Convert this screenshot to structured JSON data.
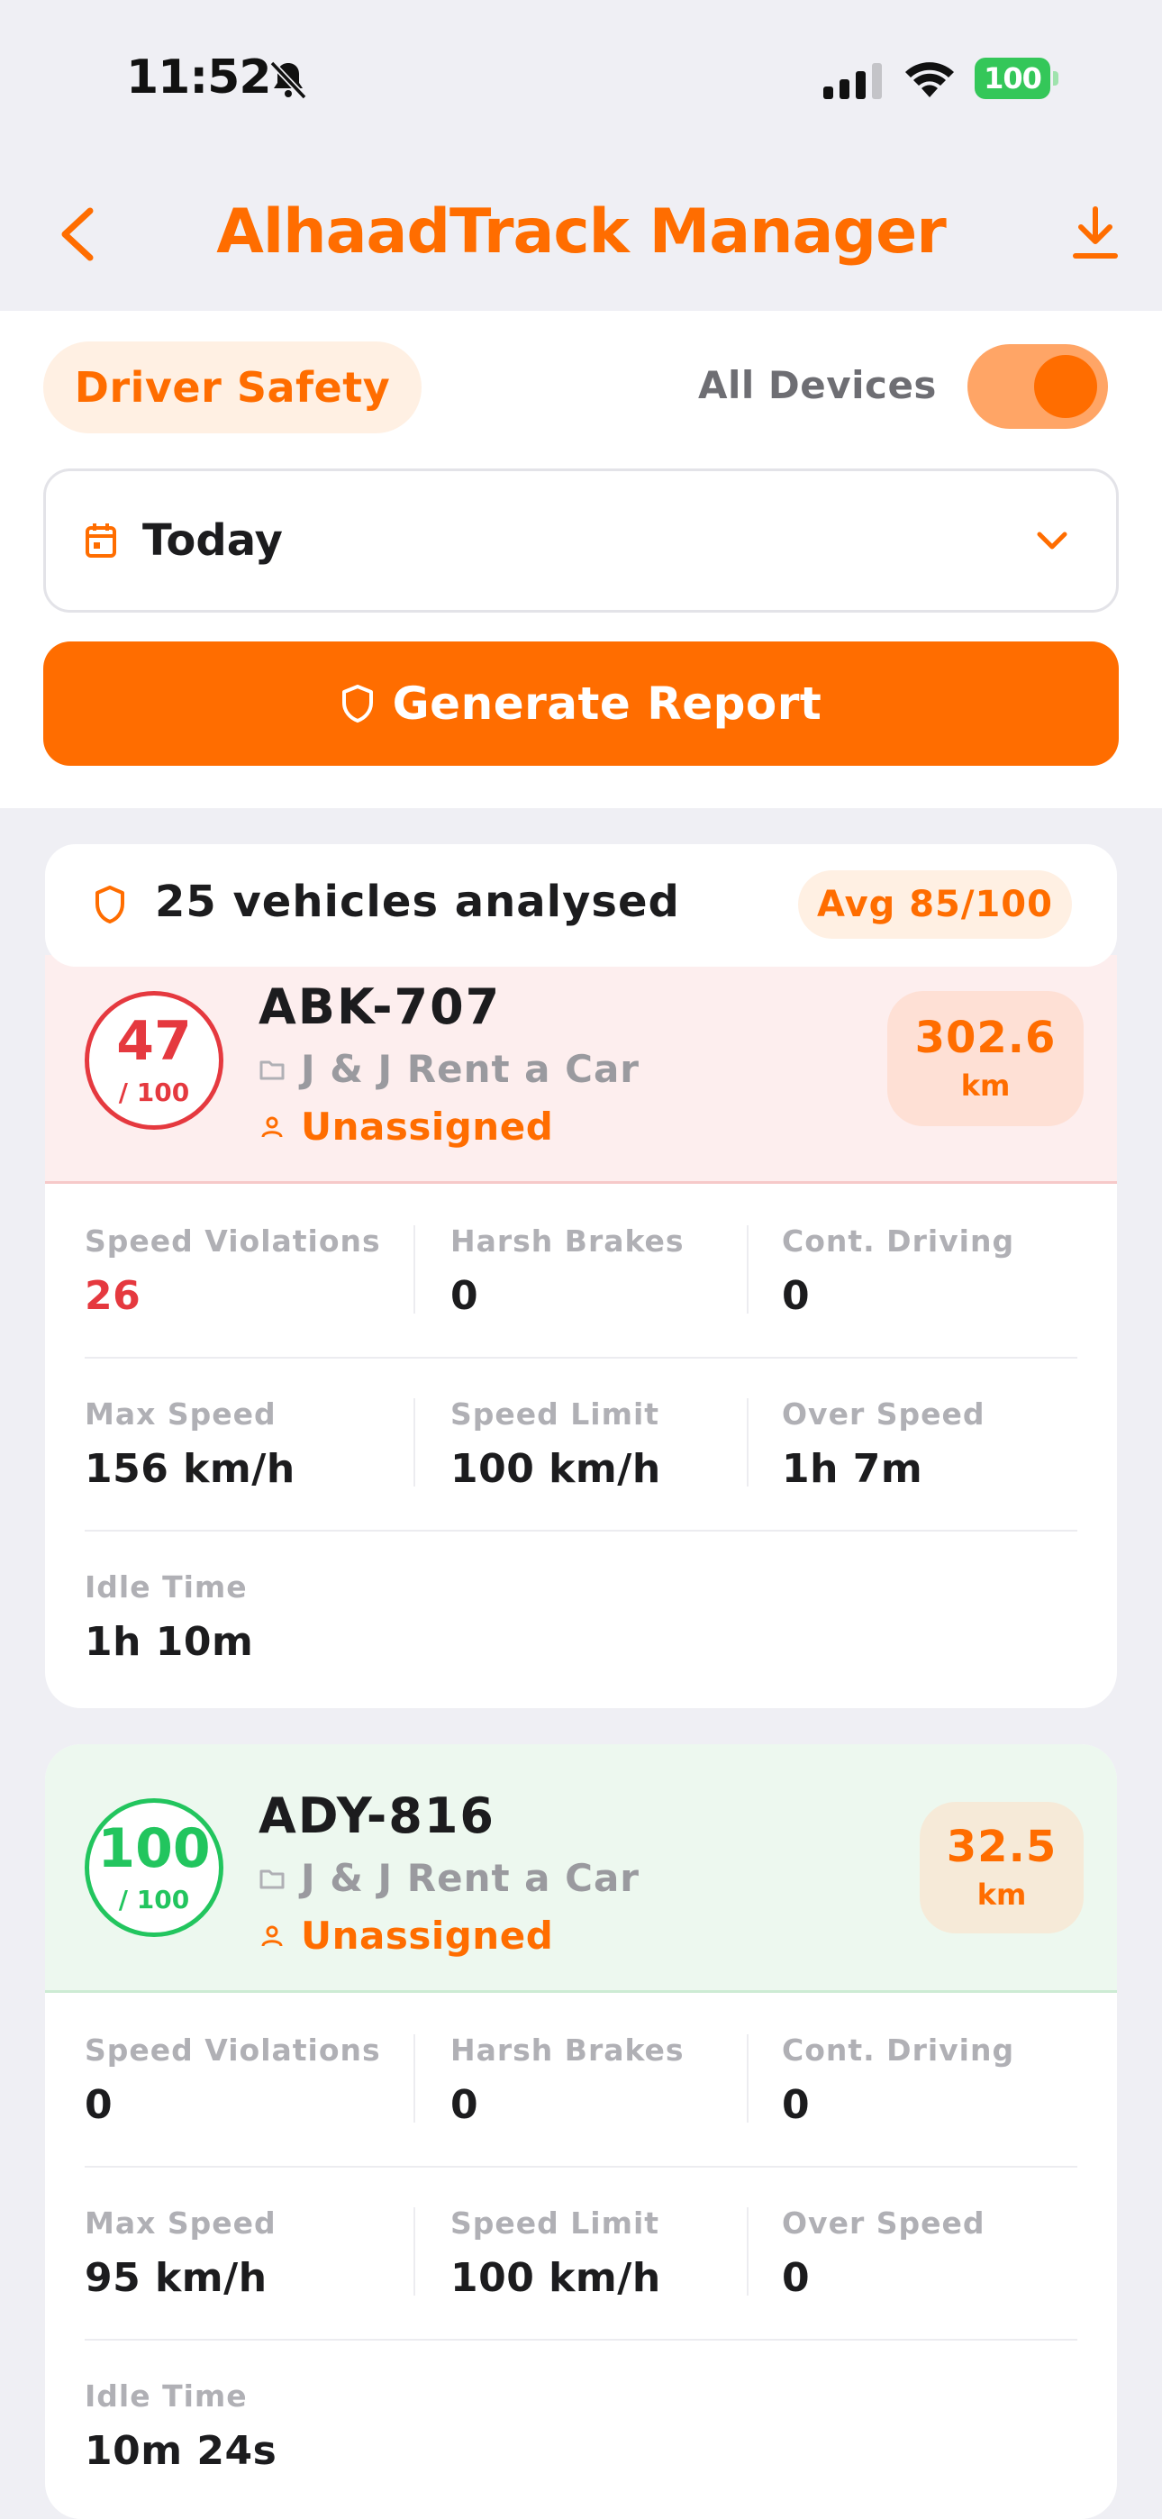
{
  "status_bar": {
    "time": "11:52",
    "battery": "100"
  },
  "nav": {
    "title": "AlhaadTrack Manager"
  },
  "controls": {
    "mode_chip": "Driver Safety",
    "all_devices_label": "All Devices",
    "all_devices_on": true,
    "date_value": "Today",
    "generate_label": "Generate Report"
  },
  "summary": {
    "text": "25 vehicles analysed",
    "avg": "Avg 85/100"
  },
  "vehicles": [
    {
      "score": "47",
      "score_max": "/ 100",
      "plate": "ABK-707",
      "company": "J & J Rent a Car",
      "driver": "Unassigned",
      "km": "302.6",
      "km_unit": "km",
      "stats": {
        "speed_violations_label": "Speed Violations",
        "speed_violations": "26",
        "harsh_brakes_label": "Harsh Brakes",
        "harsh_brakes": "0",
        "cont_driving_label": "Cont. Driving",
        "cont_driving": "0",
        "max_speed_label": "Max Speed",
        "max_speed": "156 km/h",
        "speed_limit_label": "Speed Limit",
        "speed_limit": "100 km/h",
        "over_speed_label": "Over Speed",
        "over_speed": "1h 7m",
        "idle_time_label": "Idle Time",
        "idle_time": "1h 10m"
      }
    },
    {
      "score": "100",
      "score_max": "/ 100",
      "plate": "ADY-816",
      "company": "J & J Rent a Car",
      "driver": "Unassigned",
      "km": "32.5",
      "km_unit": "km",
      "stats": {
        "speed_violations_label": "Speed Violations",
        "speed_violations": "0",
        "harsh_brakes_label": "Harsh Brakes",
        "harsh_brakes": "0",
        "cont_driving_label": "Cont. Driving",
        "cont_driving": "0",
        "max_speed_label": "Max Speed",
        "max_speed": "95 km/h",
        "speed_limit_label": "Speed Limit",
        "speed_limit": "100 km/h",
        "over_speed_label": "Over Speed",
        "over_speed": "0",
        "idle_time_label": "Idle Time",
        "idle_time": "10m 24s"
      }
    }
  ],
  "colors": {
    "accent": "#ff6d00",
    "score_bad": "#e5393f",
    "score_good": "#22c55e",
    "header_bad_bg": "#fdeeee",
    "header_good_bg": "#edf8ef"
  },
  "icons": [
    "bell-slash-icon",
    "signal-icon",
    "wifi-icon",
    "back-chevron-icon",
    "download-icon",
    "calendar-icon",
    "chevron-down-icon",
    "shield-icon",
    "folder-icon",
    "person-icon"
  ]
}
